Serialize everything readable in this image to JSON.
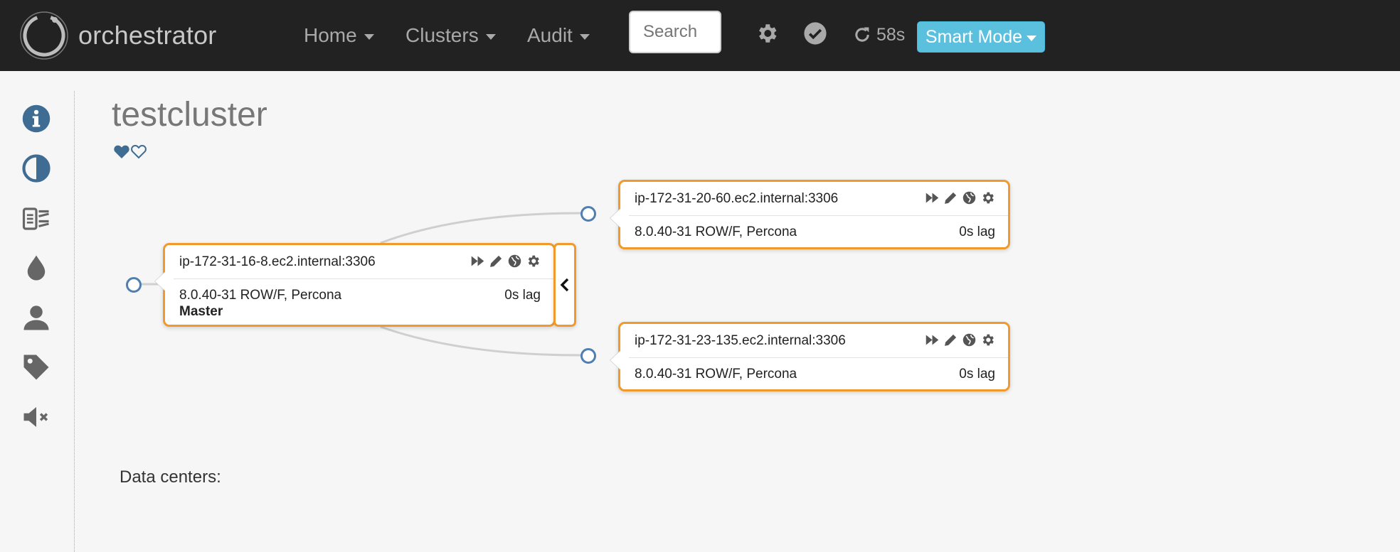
{
  "app": {
    "brand": "orchestrator"
  },
  "nav": {
    "items": [
      {
        "label": "Home"
      },
      {
        "label": "Clusters"
      },
      {
        "label": "Audit"
      }
    ],
    "search_placeholder": "Search",
    "refresh_countdown": "58s",
    "smart_mode_label": "Smart Mode"
  },
  "sidebar": {
    "icons": [
      "info-icon",
      "contrast-icon",
      "slideshow-icon",
      "drop-icon",
      "user-icon",
      "tag-icon",
      "mute-icon"
    ]
  },
  "page": {
    "title": "testcluster"
  },
  "topology": {
    "instances": [
      {
        "name": "ip-172-31-16-8.ec2.internal:3306",
        "version": "8.0.40-31 ROW/F, Percona",
        "lag": "0s lag",
        "role": "Master"
      },
      {
        "name": "ip-172-31-20-60.ec2.internal:3306",
        "version": "8.0.40-31 ROW/F, Percona",
        "lag": "0s lag"
      },
      {
        "name": "ip-172-31-23-135.ec2.internal:3306",
        "version": "8.0.40-31 ROW/F, Percona",
        "lag": "0s lag"
      }
    ]
  },
  "footer": {
    "data_centers_label": "Data centers:"
  },
  "colors": {
    "navbar": "#222222",
    "accent_orange": "#f0992d",
    "smart_mode": "#5bc0de",
    "icon_blue": "#3f6c93"
  }
}
